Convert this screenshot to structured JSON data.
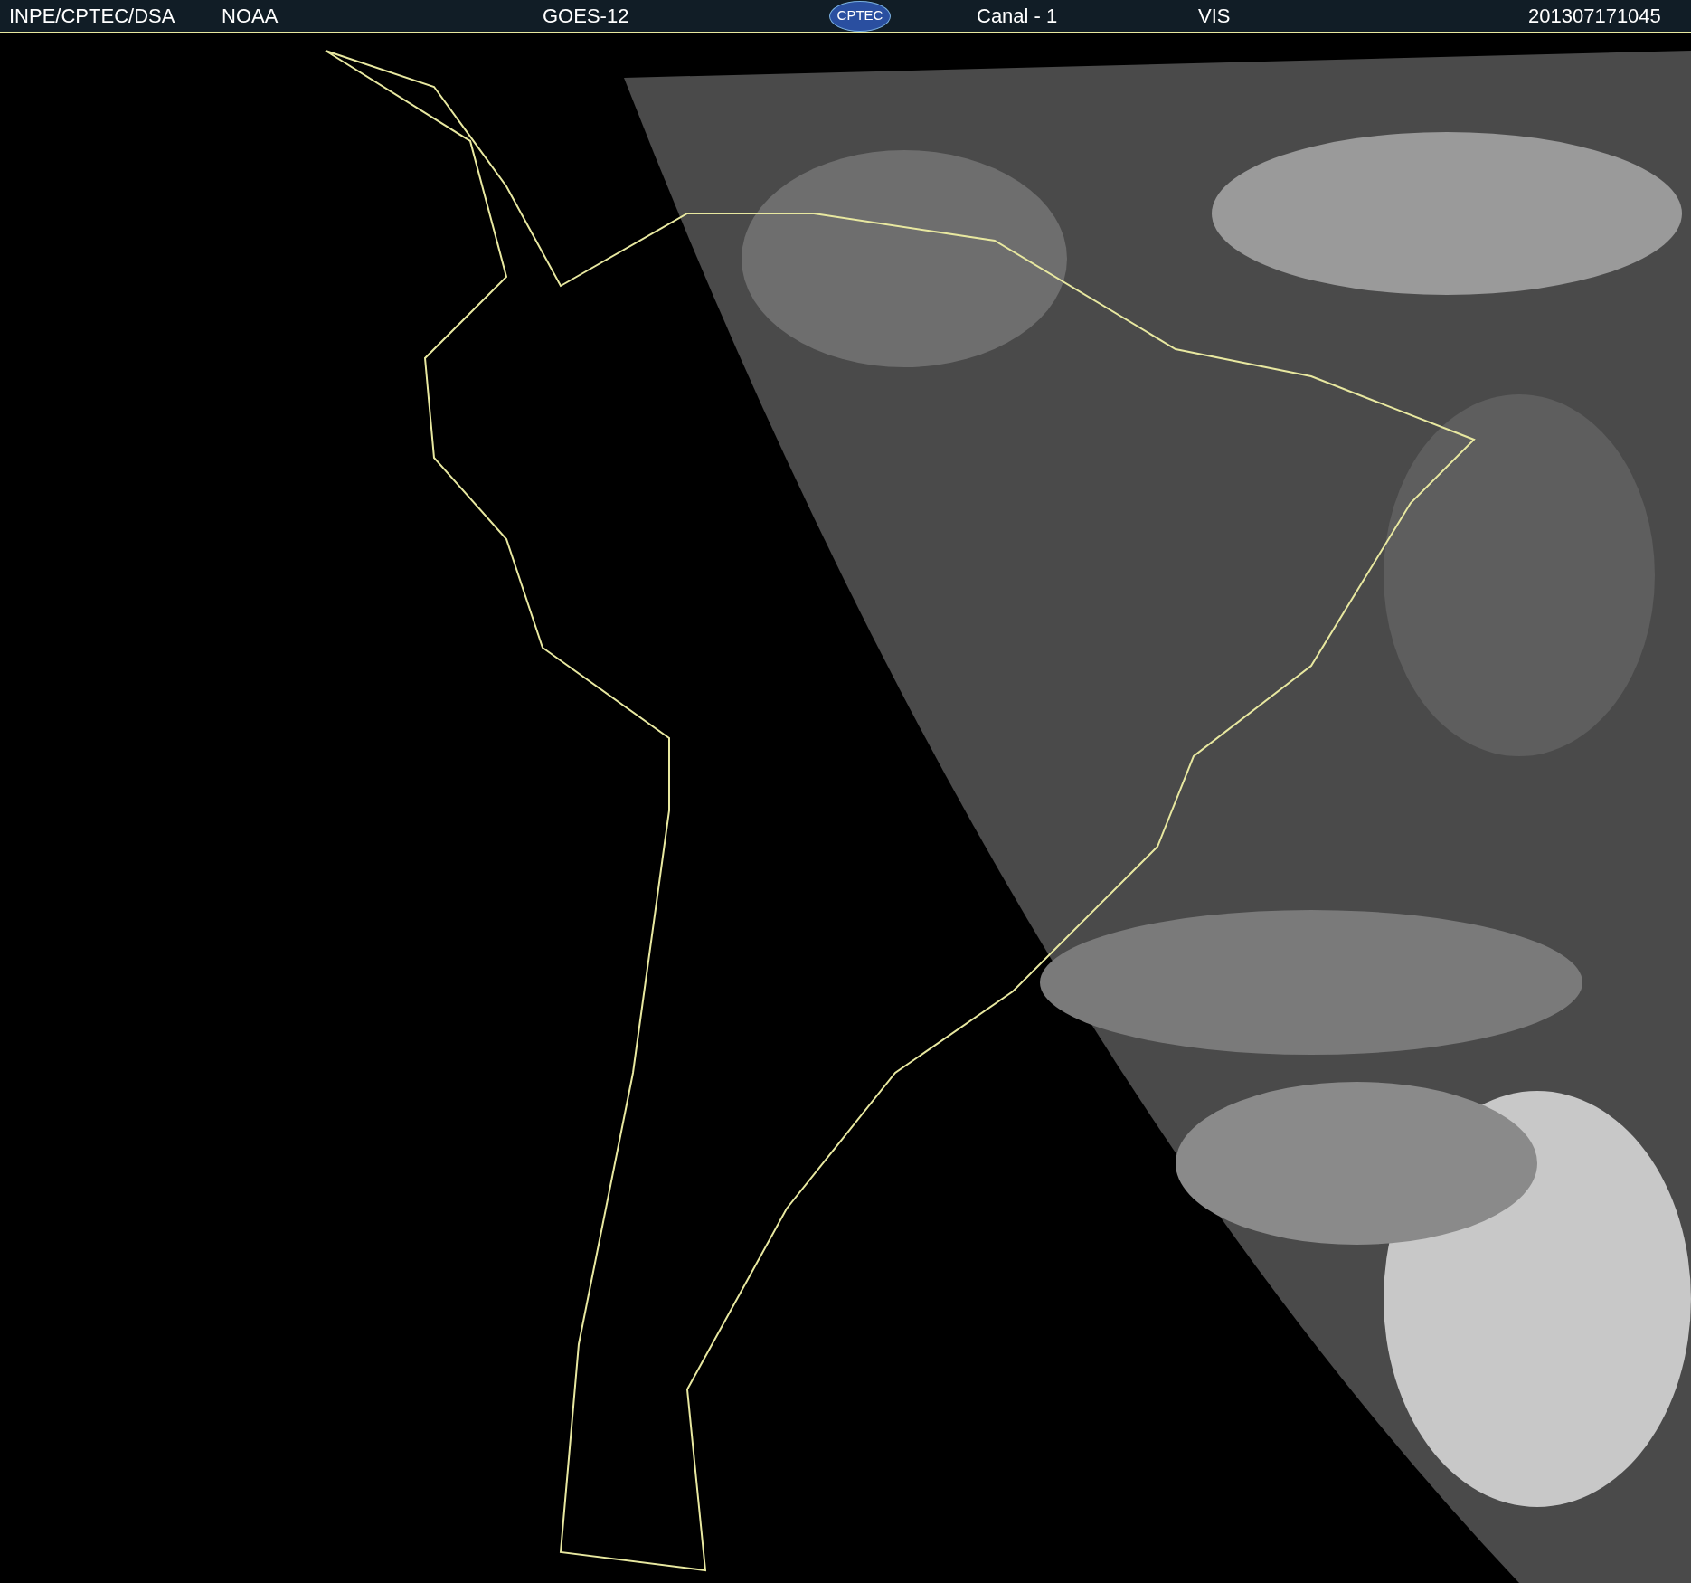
{
  "header": {
    "institution": "INPE/CPTEC/DSA",
    "agency": "NOAA",
    "satellite": "GOES-12",
    "logo_text": "CPTEC",
    "channel": "Canal - 1",
    "band": "VIS",
    "timestamp": "201307171045"
  }
}
